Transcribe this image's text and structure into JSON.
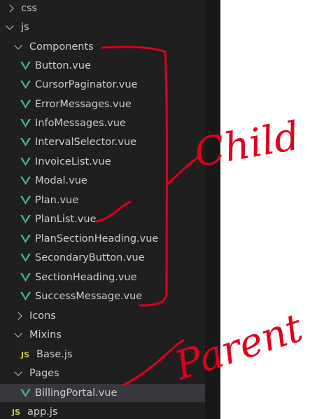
{
  "tree": {
    "css": "css",
    "js": "js",
    "components": {
      "label": "Components",
      "files": [
        "Button.vue",
        "CursorPaginator.vue",
        "ErrorMessages.vue",
        "InfoMessages.vue",
        "IntervalSelector.vue",
        "InvoiceList.vue",
        "Modal.vue",
        "Plan.vue",
        "PlanList.vue",
        "PlanSectionHeading.vue",
        "SecondaryButton.vue",
        "SectionHeading.vue",
        "SuccessMessage.vue"
      ]
    },
    "icons": "Icons",
    "mixins": {
      "label": "Mixins",
      "files": [
        "Base.js"
      ]
    },
    "pages": {
      "label": "Pages",
      "files": [
        "BillingPortal.vue"
      ]
    },
    "app_js": "app.js",
    "js_badge": "JS"
  },
  "colors": {
    "vue": "#42b883",
    "js": "#cbcb41",
    "annotation": "#e0001a"
  },
  "annotations": {
    "child": "Child",
    "parent": "Parent"
  }
}
